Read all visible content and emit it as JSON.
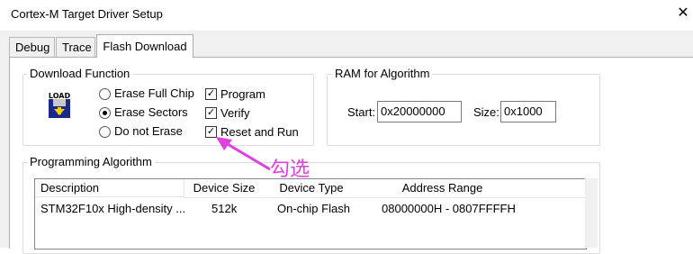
{
  "window": {
    "title": "Cortex-M Target Driver Setup",
    "close_glyph": "✕"
  },
  "tabs": [
    {
      "label": "Debug",
      "active": false
    },
    {
      "label": "Trace",
      "active": false
    },
    {
      "label": "Flash Download",
      "active": true
    }
  ],
  "download_function": {
    "legend": "Download Function",
    "icon_text": "LOAD",
    "radios": [
      {
        "label": "Erase Full Chip",
        "checked": false
      },
      {
        "label": "Erase Sectors",
        "checked": true
      },
      {
        "label": "Do not Erase",
        "checked": false
      }
    ],
    "checks": [
      {
        "label": "Program",
        "checked": true
      },
      {
        "label": "Verify",
        "checked": true
      },
      {
        "label": "Reset and Run",
        "checked": true
      }
    ]
  },
  "ram": {
    "legend": "RAM for Algorithm",
    "start_label": "Start:",
    "start_value": "0x20000000",
    "size_label": "Size:",
    "size_value": "0x1000"
  },
  "programming": {
    "legend": "Programming Algorithm",
    "columns": [
      "Description",
      "Device Size",
      "Device Type",
      "Address Range"
    ],
    "rows": [
      [
        "STM32F10x High-density ...",
        "512k",
        "On-chip Flash",
        "08000000H - 0807FFFFH"
      ]
    ]
  },
  "annotation": {
    "text": "勾选",
    "color": "#e040e0"
  }
}
